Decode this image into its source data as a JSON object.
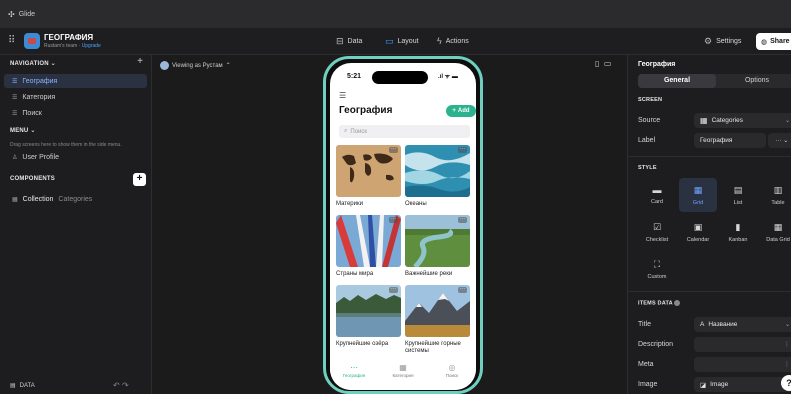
{
  "window": {
    "title": "Glide"
  },
  "toolbar": {
    "app_name": "ГЕОГРАФИЯ",
    "team": "Rustam's team",
    "upgrade": "Upgrade",
    "data_label": "Data",
    "layout_label": "Layout",
    "actions_label": "Actions",
    "settings_label": "Settings",
    "share_label": "Share"
  },
  "sidebar": {
    "navigation_header": "NAVIGATION",
    "nav_items": [
      {
        "label": "География",
        "selected": true
      },
      {
        "label": "Категория",
        "selected": false
      },
      {
        "label": "Поиск",
        "selected": false
      }
    ],
    "menu_header": "MENU",
    "menu_hint": "Drag screens here to show them in the side menu.",
    "user_profile": "User Profile",
    "components_header": "COMPONENTS",
    "component": {
      "label": "Collection",
      "source": "Categories"
    },
    "footer_label": "DATA"
  },
  "canvas": {
    "viewing_as": "Viewing as Рустам"
  },
  "phone": {
    "time": "5:21",
    "status": ".ıl ᯤ ▬",
    "title": "География",
    "add_label": "Add",
    "search_placeholder": "Поиск",
    "cards": [
      {
        "caption": "Материки"
      },
      {
        "caption": "Океаны"
      },
      {
        "caption": "Страны мира"
      },
      {
        "caption": "Важнейшие реки"
      },
      {
        "caption": "Крупнейшие озёра"
      },
      {
        "caption": "Крупнейшие горные системы"
      }
    ],
    "tabs": [
      {
        "label": "География"
      },
      {
        "label": "Категория"
      },
      {
        "label": "Поиск"
      }
    ]
  },
  "panel": {
    "title": "География",
    "tab_general": "General",
    "tab_options": "Options",
    "screen_header": "SCREEN",
    "source_label": "Source",
    "source_value": "Categories",
    "label_label": "Label",
    "label_value": "География",
    "style_header": "STYLE",
    "styles": [
      {
        "label": "Card",
        "icon": "card-icon"
      },
      {
        "label": "Grid",
        "icon": "grid-icon"
      },
      {
        "label": "List",
        "icon": "list-icon"
      },
      {
        "label": "Table",
        "icon": "table-icon"
      },
      {
        "label": "Checklist",
        "icon": "checklist-icon"
      },
      {
        "label": "Calendar",
        "icon": "calendar-icon"
      },
      {
        "label": "Kanban",
        "icon": "kanban-icon"
      },
      {
        "label": "Data Grid",
        "icon": "data-grid-icon"
      },
      {
        "label": "Custom",
        "icon": "custom-icon"
      }
    ],
    "selected_style": "Grid",
    "items_data_header": "ITEMS DATA",
    "title_label": "Title",
    "title_value": "Название",
    "title_prefix": "A",
    "description_label": "Description",
    "meta_label": "Meta",
    "image_label": "Image",
    "image_value": "Image"
  },
  "colors": {
    "accent": "#2bb38f",
    "selection": "#6fa4ff",
    "phone_frame": "#6fd0c0"
  }
}
